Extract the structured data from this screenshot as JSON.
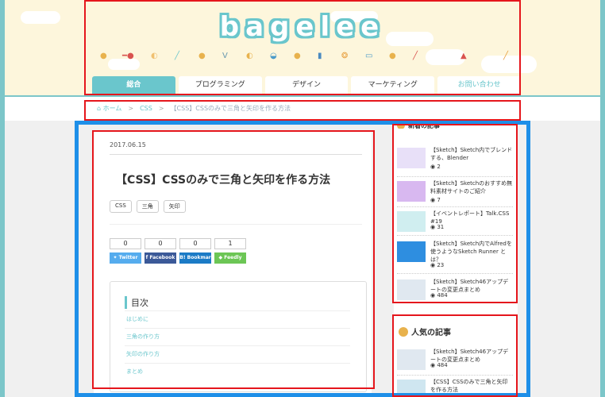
{
  "site": {
    "logo": "bagelee"
  },
  "decorations": [
    "●",
    "━●",
    "◐",
    "╱",
    "●",
    "V",
    "◐",
    "◒",
    "●",
    "▮",
    "❂",
    "▭",
    "●",
    "╱",
    "▲",
    "╱"
  ],
  "nav": {
    "tabs": [
      {
        "label": "総合",
        "active": true
      },
      {
        "label": "プログラミング",
        "active": false
      },
      {
        "label": "デザイン",
        "active": false
      },
      {
        "label": "マーケティング",
        "active": false
      },
      {
        "label": "お問い合わせ",
        "active": false
      }
    ]
  },
  "breadcrumb": {
    "home": "ホーム",
    "category": "CSS",
    "current": "【CSS】CSSのみで三角と矢印を作る方法"
  },
  "article": {
    "date": "2017.06.15",
    "title": "【CSS】CSSのみで三角と矢印を作る方法",
    "tags": [
      "CSS",
      "三角",
      "矢印"
    ],
    "shares": [
      {
        "count": "0",
        "label": "Twitter",
        "color": "#55acee",
        "icon": "twitter-icon"
      },
      {
        "count": "0",
        "label": "Facebook",
        "color": "#3b5998",
        "icon": "facebook-icon"
      },
      {
        "count": "0",
        "label": "Bookmar",
        "color": "#1b7bc6",
        "icon": "bookmark-icon"
      },
      {
        "count": "1",
        "label": "Feedly",
        "color": "#6cc655",
        "icon": "feedly-icon"
      }
    ],
    "toc": {
      "title": "目次",
      "items": [
        "はじめに",
        "三角の作り方",
        "矢印の作り方",
        "まとめ"
      ]
    }
  },
  "sidebar": {
    "recent": {
      "heading": "新着の記事",
      "items": [
        {
          "title": "【Sketch】Sketch内でブレンドする、Blender",
          "views": "2",
          "thumb": "#e8e0f8"
        },
        {
          "title": "【Sketch】Sketchのおすすめ無料素材サイトのご紹介",
          "views": "7",
          "thumb": "#d8b8f0"
        },
        {
          "title": "【イベントレポート】Talk.CSS #19",
          "views": "31",
          "thumb": "#d0eef0"
        },
        {
          "title": "【Sketch】Sketch内でAlfredを使うようなSketch Runner とは？",
          "views": "23",
          "thumb": "#2e8ee0"
        },
        {
          "title": "【Sketch】Sketch46アップデートの変更点まとめ",
          "views": "484",
          "thumb": "#e0e8f0"
        }
      ]
    },
    "popular": {
      "heading": "人気の記事",
      "items": [
        {
          "title": "【Sketch】Sketch46アップデートの変更点まとめ",
          "views": "484",
          "thumb": "#e0e8f0"
        },
        {
          "title": "【CSS】CSSのみで三角と矢印を作る方法",
          "views": "",
          "thumb": "#cfe6f0"
        }
      ]
    }
  }
}
